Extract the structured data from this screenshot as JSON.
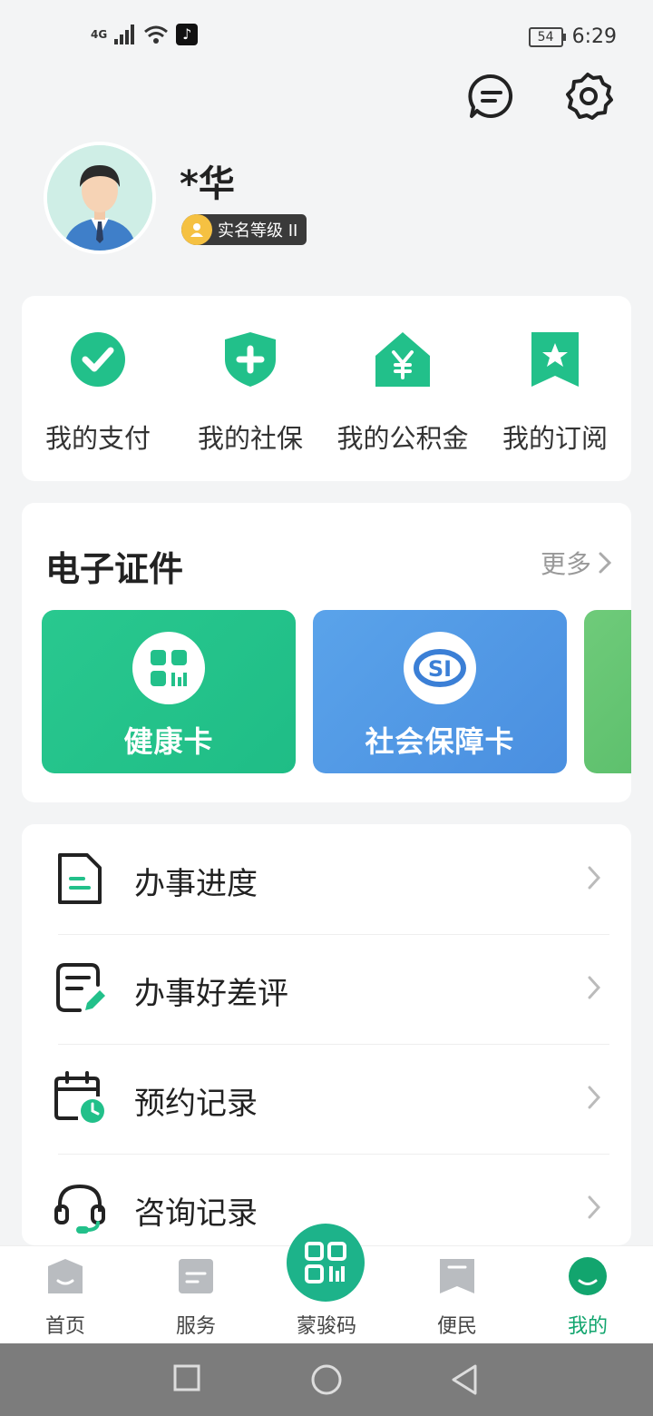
{
  "status_bar": {
    "network": "4G",
    "battery": "54",
    "time": "6:29"
  },
  "top_icons": [
    "message-icon",
    "settings-icon"
  ],
  "profile": {
    "name": "*华",
    "verify_badge": "实名等级 II"
  },
  "quick_actions": [
    {
      "label": "我的支付",
      "icon": "check-circle-icon"
    },
    {
      "label": "我的社保",
      "icon": "shield-plus-icon"
    },
    {
      "label": "我的公积金",
      "icon": "house-yen-icon"
    },
    {
      "label": "我的订阅",
      "icon": "bookmark-star-icon"
    }
  ],
  "certificates": {
    "title": "电子证件",
    "more": "更多",
    "cards": [
      {
        "label": "健康卡",
        "icon": "qr-grid-icon"
      },
      {
        "label": "社会保障卡",
        "icon": "si-logo-icon"
      }
    ]
  },
  "menu": [
    {
      "label": "办事进度",
      "icon": "document-icon"
    },
    {
      "label": "办事好差评",
      "icon": "edit-doc-icon"
    },
    {
      "label": "预约记录",
      "icon": "calendar-clock-icon"
    },
    {
      "label": "咨询记录",
      "icon": "headset-icon"
    }
  ],
  "tabbar": {
    "tabs": [
      {
        "label": "首页",
        "icon": "home-icon"
      },
      {
        "label": "服务",
        "icon": "service-icon"
      },
      {
        "label": "蒙骏码",
        "icon": "qr-code-icon"
      },
      {
        "label": "便民",
        "icon": "bookmark-icon"
      },
      {
        "label": "我的",
        "icon": "profile-icon"
      }
    ],
    "active": "我的"
  },
  "colors": {
    "accent": "#1db38a",
    "active_tab": "#12a56e",
    "health_card": "#22c08a",
    "social_card": "#4f97e4"
  }
}
